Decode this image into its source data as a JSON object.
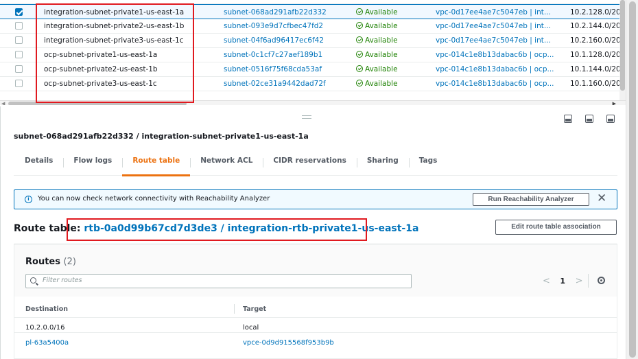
{
  "subnets": {
    "rows": [
      {
        "name": "integration-subnet-private1-us-east-1a",
        "id": "subnet-068ad291afb22d332",
        "state": "Available",
        "vpc": "vpc-0d17ee4ae7c5047eb | int...",
        "cidr": "10.2.128.0/20",
        "selected": true
      },
      {
        "name": "integration-subnet-private2-us-east-1b",
        "id": "subnet-093e9d7cfbec47fd2",
        "state": "Available",
        "vpc": "vpc-0d17ee4ae7c5047eb | int...",
        "cidr": "10.2.144.0/20",
        "selected": false
      },
      {
        "name": "integration-subnet-private3-us-east-1c",
        "id": "subnet-04f6ad96417ec6f42",
        "state": "Available",
        "vpc": "vpc-0d17ee4ae7c5047eb | int...",
        "cidr": "10.2.160.0/20",
        "selected": false
      },
      {
        "name": "ocp-subnet-private1-us-east-1a",
        "id": "subnet-0c1cf7c27aef189b1",
        "state": "Available",
        "vpc": "vpc-014c1e8b13dabac6b | ocp...",
        "cidr": "10.1.128.0/20",
        "selected": false
      },
      {
        "name": "ocp-subnet-private2-us-east-1b",
        "id": "subnet-0516f75f68cda53af",
        "state": "Available",
        "vpc": "vpc-014c1e8b13dabac6b | ocp...",
        "cidr": "10.1.144.0/20",
        "selected": false
      },
      {
        "name": "ocp-subnet-private3-us-east-1c",
        "id": "subnet-02ce31a9442dad72f",
        "state": "Available",
        "vpc": "vpc-014c1e8b13dabac6b | ocp...",
        "cidr": "10.1.160.0/20",
        "selected": false
      }
    ]
  },
  "detail": {
    "title": "subnet-068ad291afb22d332 / integration-subnet-private1-us-east-1a",
    "tabs": [
      {
        "label": "Details",
        "active": false
      },
      {
        "label": "Flow logs",
        "active": false
      },
      {
        "label": "Route table",
        "active": true
      },
      {
        "label": "Network ACL",
        "active": false
      },
      {
        "label": "CIDR reservations",
        "active": false
      },
      {
        "label": "Sharing",
        "active": false
      },
      {
        "label": "Tags",
        "active": false
      }
    ],
    "info_banner": {
      "text": "You can now check network connectivity with Reachability Analyzer",
      "button": "Run Reachability Analyzer",
      "close": "✕"
    },
    "route_table": {
      "label": "Route table:",
      "link": "rtb-0a0d99b67cd7d3de3 / integration-rtb-private1-us-east-1a",
      "edit_button": "Edit route table association"
    },
    "routes": {
      "title": "Routes",
      "count": "(2)",
      "filter_placeholder": "Filter routes",
      "page": "1",
      "columns": [
        "Destination",
        "Target"
      ],
      "rows": [
        {
          "destination": "10.2.0.0/16",
          "target": "local",
          "dest_link": false,
          "target_link": false
        },
        {
          "destination": "pl-63a5400a",
          "target": "vpce-0d9d915568f953b9b",
          "dest_link": true,
          "target_link": true
        }
      ]
    }
  },
  "colors": {
    "accent": "#0073bb",
    "active_tab": "#ec7211",
    "available": "#1d8102",
    "highlight_box": "#e0191f"
  }
}
